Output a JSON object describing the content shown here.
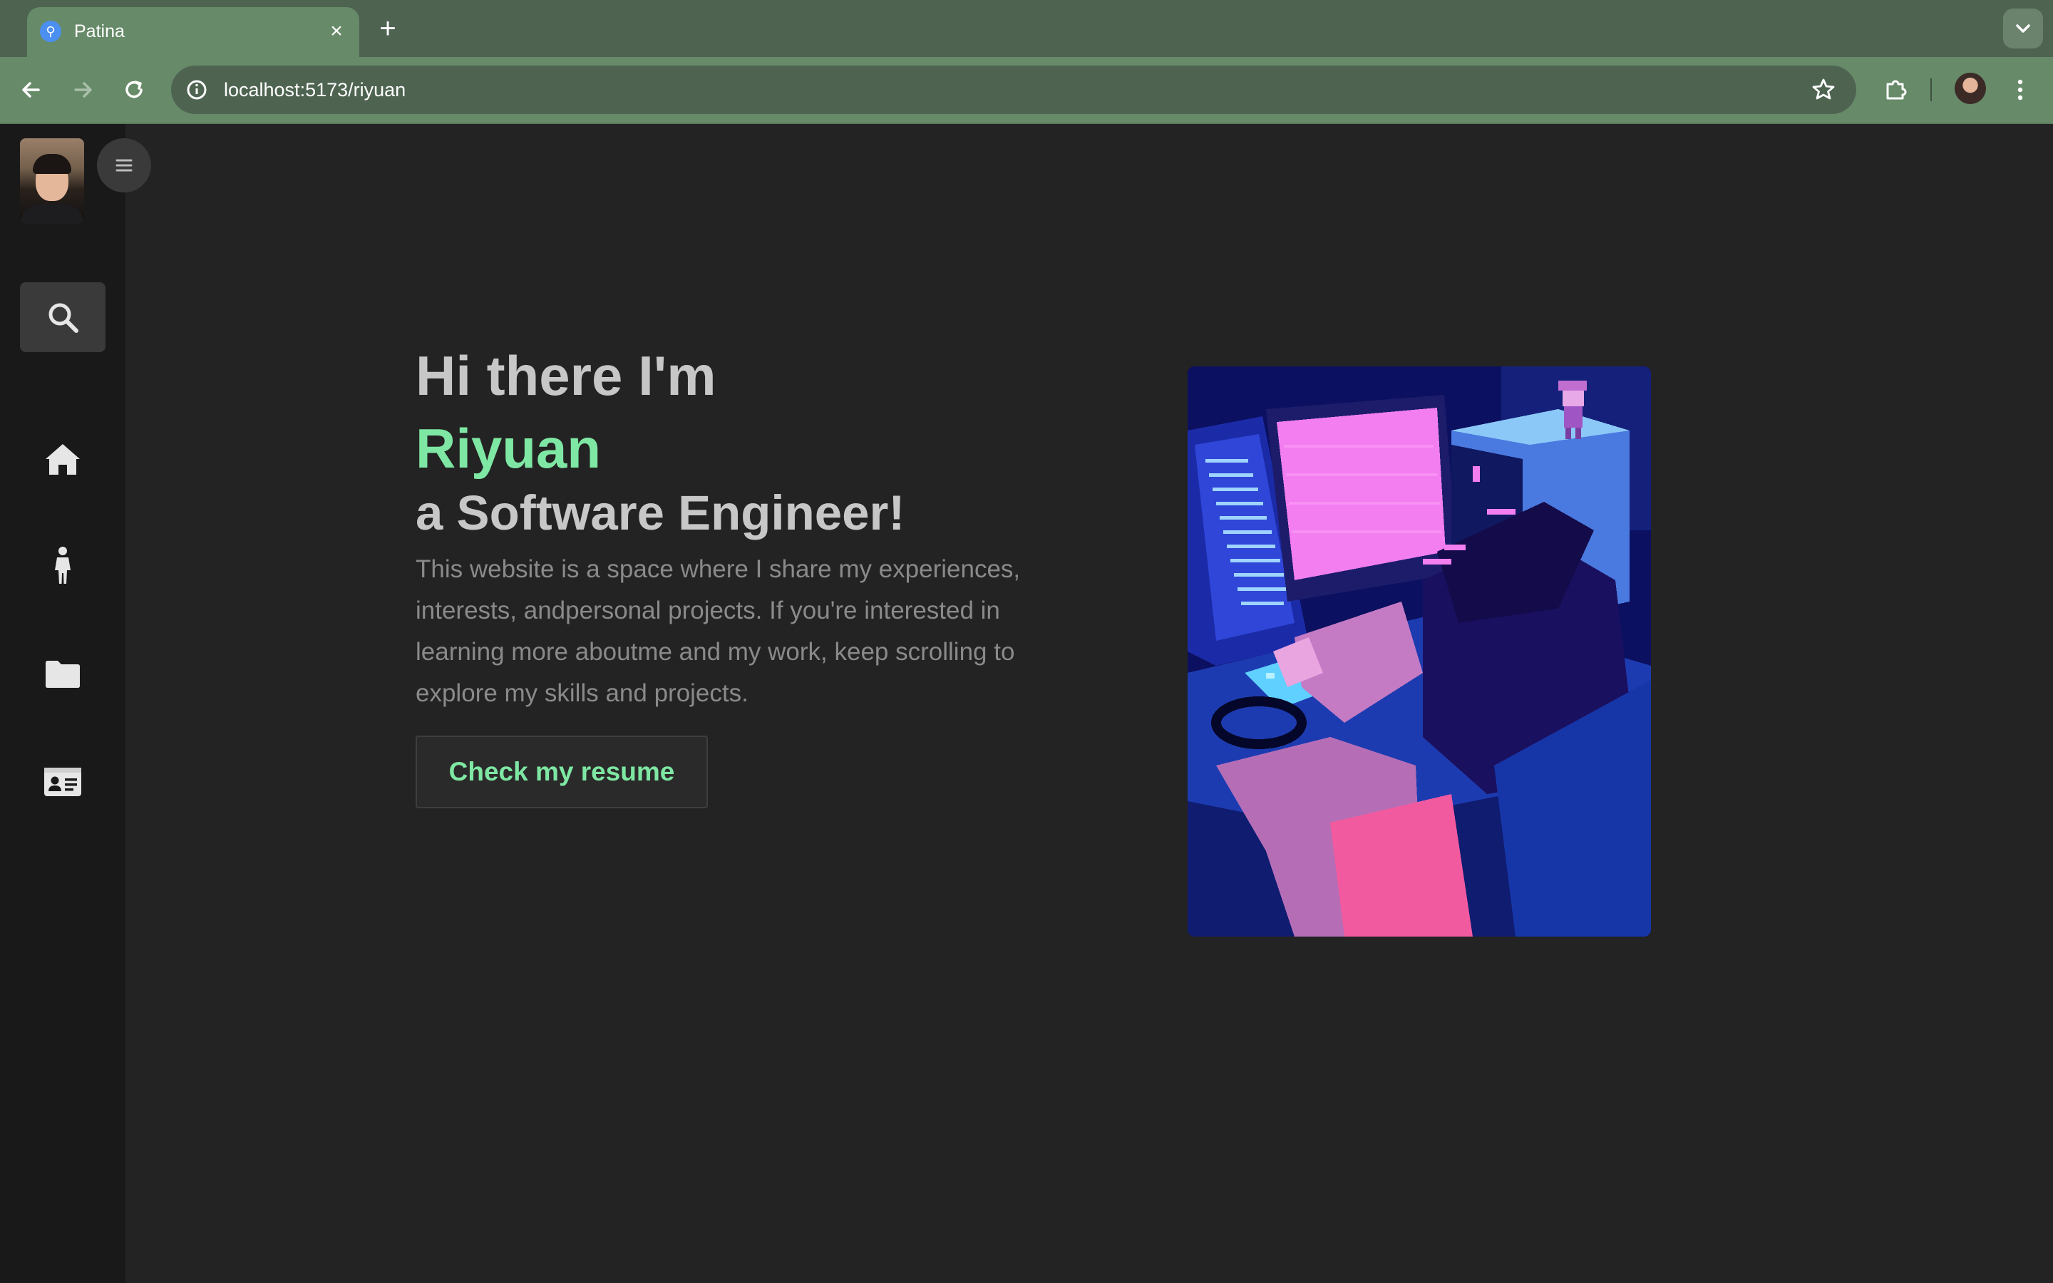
{
  "browser": {
    "tab_title": "Patina",
    "tab_close": "×",
    "new_tab": "+",
    "url": "localhost:5173/riyuan"
  },
  "sidebar": {
    "items": [
      {
        "name": "search",
        "icon": "search-icon",
        "active": true
      },
      {
        "name": "home",
        "icon": "home-icon"
      },
      {
        "name": "about",
        "icon": "person-icon"
      },
      {
        "name": "projects",
        "icon": "folder-icon"
      },
      {
        "name": "contact",
        "icon": "id-card-icon"
      }
    ]
  },
  "hero": {
    "greeting": "Hi there I'm",
    "name": "Riyuan",
    "role": "a Software Engineer!",
    "description": "This website is a space where I share my experiences, interests, andpersonal projects. If you're interested in learning more aboutme and my work, keep scrolling to explore my skills and projects.",
    "resume_button": "Check my resume"
  },
  "colors": {
    "accent": "#7ee7a3",
    "background": "#232323",
    "sidebar": "#191919",
    "chrome": "#678a69"
  }
}
